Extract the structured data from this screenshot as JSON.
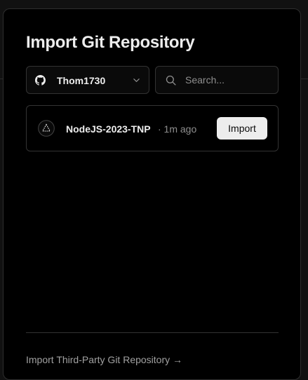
{
  "dialog": {
    "title": "Import Git Repository"
  },
  "account_selector": {
    "provider_icon": "github-icon",
    "account_name": "Thom1730",
    "dropdown_icon": "chevron-down-icon"
  },
  "search": {
    "icon": "search-icon",
    "placeholder": "Search...",
    "value": ""
  },
  "repositories": [
    {
      "icon": "triangle-logo-icon",
      "name": "NodeJS-2023-TNP",
      "meta": "· 1m ago",
      "action_label": "Import"
    }
  ],
  "footer": {
    "third_party_link": "Import Third-Party Git Repository →"
  },
  "colors": {
    "background": "#000000",
    "border": "#333333",
    "text_primary": "#ededed",
    "text_muted": "#8f8f8f",
    "button_bg": "#ededed"
  }
}
